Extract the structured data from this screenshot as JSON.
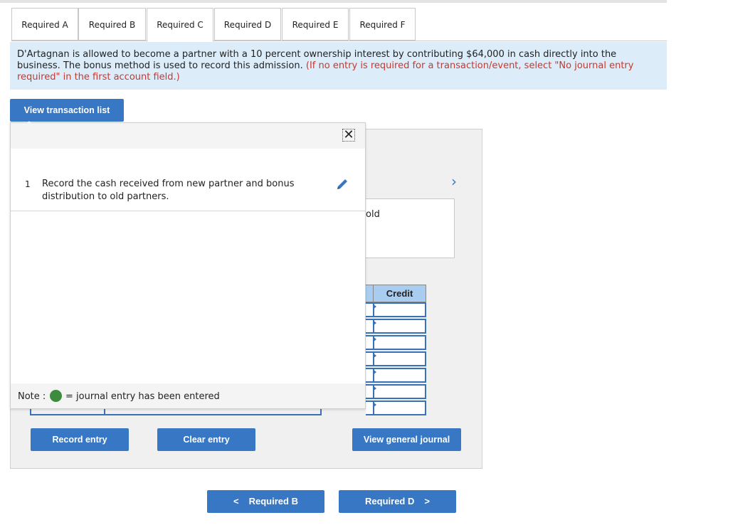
{
  "tabs": [
    {
      "label": "Required A"
    },
    {
      "label": "Required B"
    },
    {
      "label": "Required C"
    },
    {
      "label": "Required D"
    },
    {
      "label": "Required E"
    },
    {
      "label": "Required F"
    }
  ],
  "active_tab": "Required C",
  "instructions": {
    "text": "D'Artagnan is allowed to become a partner with a 10 percent ownership interest by contributing $64,000 in cash directly into the business. The bonus method is used to record this admission.",
    "note": "(If no entry is required for a transaction/event, select \"No journal entry required\" in the first account field.)"
  },
  "view_transaction_list": "View transaction list",
  "popup": {
    "close_symbol": "✕",
    "transactions": [
      {
        "number": "1",
        "description": "Record the cash received from new partner and bonus distribution to old partners."
      }
    ],
    "note_label": "Note :",
    "note_text": "= journal entry has been entered"
  },
  "journal": {
    "description_partial": "old",
    "credit_header": "Credit",
    "next_arrow": "›"
  },
  "buttons": {
    "record_entry": "Record entry",
    "clear_entry": "Clear entry",
    "view_general_journal": "View general journal"
  },
  "nav": {
    "prev_label": "Required B",
    "prev_chevron": "<",
    "next_label": "Required D",
    "next_chevron": ">"
  },
  "colors": {
    "button_blue": "#3877c4",
    "instruction_bg": "#dcedf9",
    "note_red": "#c8372d",
    "entered_green": "#3d8b3d"
  }
}
